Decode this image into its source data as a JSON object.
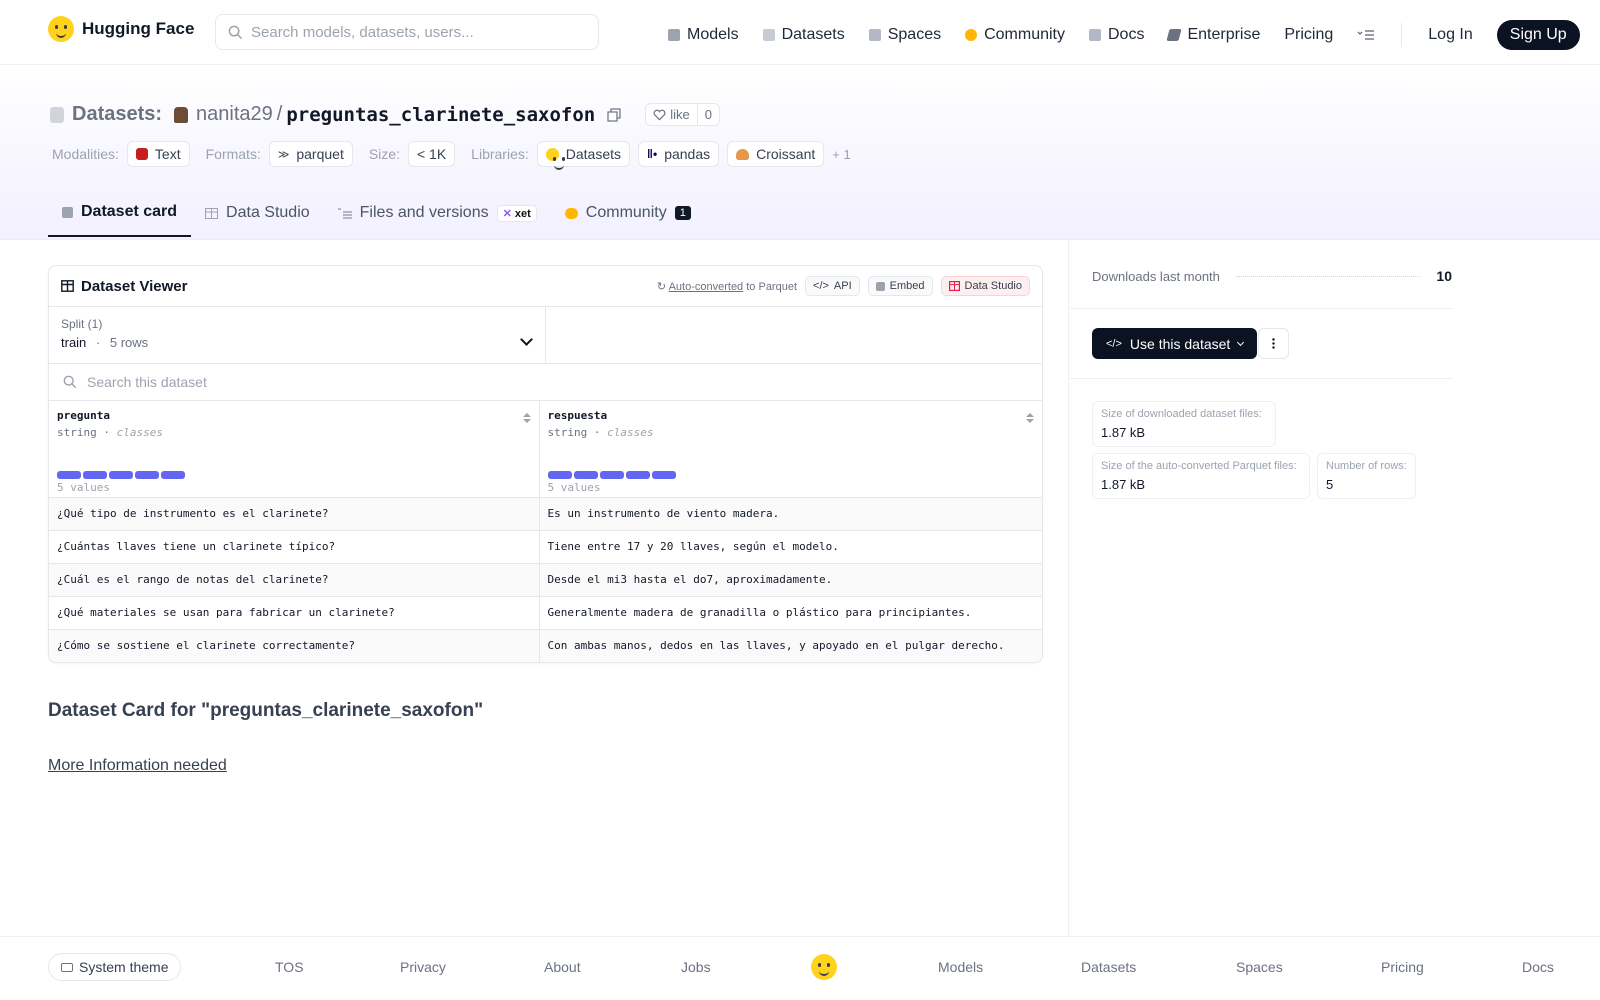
{
  "header": {
    "brand": "Hugging Face",
    "search_placeholder": "Search models, datasets, users...",
    "nav": [
      {
        "label": "Models",
        "color": "#9ca3af"
      },
      {
        "label": "Datasets",
        "color": "#c7cbd4"
      },
      {
        "label": "Spaces",
        "color": "#b4b8c6"
      },
      {
        "label": "Community",
        "color": "#ffb700"
      },
      {
        "label": "Docs",
        "color": "#b4b8c6"
      },
      {
        "label": "Enterprise",
        "color": "#6b7280"
      },
      {
        "label": "Pricing"
      }
    ],
    "login": "Log In",
    "signup": "Sign Up"
  },
  "repo": {
    "section": "Datasets:",
    "owner": "nanita29",
    "slash": "/",
    "name": "preguntas_clarinete_saxofon",
    "like_label": "like",
    "like_count": "0",
    "tags": {
      "modalities_label": "Modalities:",
      "modality": "Text",
      "formats_label": "Formats:",
      "format": "parquet",
      "size_label": "Size:",
      "size": "< 1K",
      "libraries_label": "Libraries:",
      "libraries": [
        "Datasets",
        "pandas",
        "Croissant"
      ],
      "more": "+ 1"
    },
    "tabs": {
      "card": "Dataset card",
      "studio": "Data Studio",
      "files": "Files and versions",
      "xet": "xet",
      "community": "Community",
      "community_count": "1"
    }
  },
  "viewer": {
    "title": "Dataset Viewer",
    "auto_converted": "Auto-converted",
    "to_parquet": "to Parquet",
    "api": "API",
    "embed": "Embed",
    "data_studio": "Data Studio",
    "split_caption": "Split (1)",
    "split_name": "train",
    "split_sep": "·",
    "split_rows": "5 rows",
    "search_placeholder": "Search this dataset",
    "columns": [
      {
        "name": "pregunta",
        "type": "string",
        "kind": "classes",
        "values": "5 values"
      },
      {
        "name": "respuesta",
        "type": "string",
        "kind": "classes",
        "values": "5 values"
      }
    ],
    "rows": [
      [
        "¿Qué tipo de instrumento es el clarinete?",
        "Es un instrumento de viento madera."
      ],
      [
        "¿Cuántas llaves tiene un clarinete típico?",
        "Tiene entre 17 y 20 llaves, según el modelo."
      ],
      [
        "¿Cuál es el rango de notas del clarinete?",
        "Desde el mi3 hasta el do7, aproximadamente."
      ],
      [
        "¿Qué materiales se usan para fabricar un clarinete?",
        "Generalmente madera de granadilla o plástico para principiantes."
      ],
      [
        "¿Cómo se sostiene el clarinete correctamente?",
        "Con ambas manos, dedos en las llaves, y apoyado en el pulgar derecho."
      ]
    ]
  },
  "card": {
    "title": "Dataset Card for \"preguntas_clarinete_saxofon\"",
    "more_info": "More Information needed"
  },
  "sidebar": {
    "downloads_label": "Downloads last month",
    "downloads": "10",
    "use_button": "Use this dataset",
    "dl_size_label": "Size of downloaded dataset files:",
    "dl_size": "1.87 kB",
    "parquet_size_label": "Size of the auto-converted Parquet files:",
    "parquet_size": "1.87 kB",
    "rows_label": "Number of rows:",
    "rows": "5"
  },
  "footer": {
    "theme": "System theme",
    "links": [
      "TOS",
      "Privacy",
      "About",
      "Jobs",
      "Models",
      "Datasets",
      "Spaces",
      "Pricing",
      "Docs"
    ]
  }
}
